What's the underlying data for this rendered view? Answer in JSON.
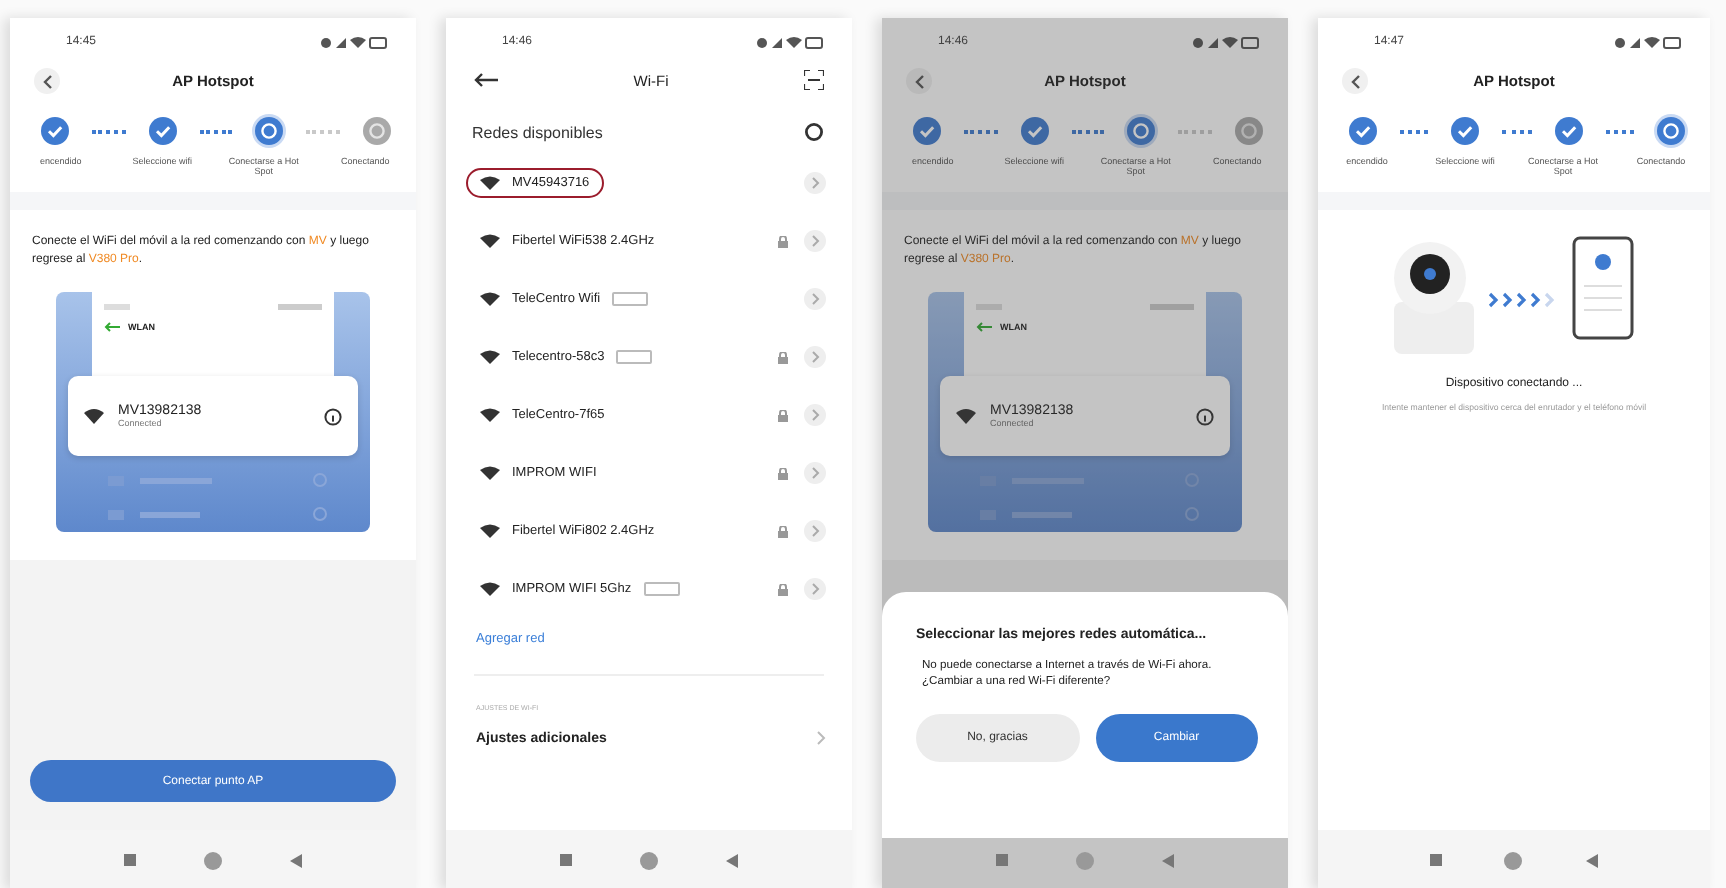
{
  "screens": [
    {
      "kind": "guide",
      "time": "14:45",
      "title": "AP Hotspot",
      "steps": [
        {
          "label": "encendido",
          "done": true,
          "current": false
        },
        {
          "label": "Seleccione wifi",
          "done": true,
          "current": false
        },
        {
          "label": "Conectarse a Hot Spot",
          "done": false,
          "current": true
        },
        {
          "label": "Conectando",
          "done": false,
          "current": false
        }
      ],
      "instruction": "Conecte el WiFi del móvil a la red comenzando con **MV** y luego regrese al **V380 Pro**.",
      "preview": {
        "header": "WLAN",
        "network": "MV13982138",
        "status": "Connected"
      },
      "button": "Conectar punto AP"
    },
    {
      "kind": "wifi",
      "time": "14:46",
      "title": "Wi-Fi",
      "section": "Redes disponibles",
      "networks": [
        {
          "name": "MV45943716",
          "secured": false,
          "band_tag": false,
          "circled": true
        },
        {
          "name": "Fibertel WiFi538 2.4GHz",
          "secured": true,
          "band_tag": false,
          "circled": false
        },
        {
          "name": "TeleCentro Wifi",
          "secured": false,
          "band_tag": true,
          "circled": false
        },
        {
          "name": "Telecentro-58c3",
          "secured": true,
          "band_tag": true,
          "circled": false
        },
        {
          "name": "TeleCentro-7f65",
          "secured": true,
          "band_tag": false,
          "circled": false
        },
        {
          "name": "IMPROM WIFI",
          "secured": true,
          "band_tag": false,
          "circled": false
        },
        {
          "name": "Fibertel WiFi802 2.4GHz",
          "secured": true,
          "band_tag": false,
          "circled": false
        },
        {
          "name": "IMPROM WIFI 5Ghz",
          "secured": true,
          "band_tag": true,
          "circled": false
        }
      ],
      "add_network": "Agregar red",
      "settings_heading": "AJUSTES DE WI-FI",
      "settings_item": "Ajustes adicionales"
    },
    {
      "kind": "guide",
      "time": "14:46",
      "title": "AP Hotspot",
      "steps": [
        {
          "label": "encendido",
          "done": true,
          "current": false
        },
        {
          "label": "Seleccione wifi",
          "done": true,
          "current": false
        },
        {
          "label": "Conectarse a Hot Spot",
          "done": false,
          "current": true
        },
        {
          "label": "Conectando",
          "done": false,
          "current": false
        }
      ],
      "instruction": "Conecte el WiFi del móvil a la red comenzando con **MV** y luego regrese al **V380 Pro**.",
      "preview": {
        "header": "WLAN",
        "network": "MV13982138",
        "status": "Connected"
      },
      "dialog": {
        "title": "Seleccionar las mejores redes automática...",
        "message": "No puede conectarse a Internet a través de Wi-Fi ahora. ¿Cambiar a una red Wi-Fi diferente?",
        "cancel": "No, gracias",
        "confirm": "Cambiar"
      }
    },
    {
      "kind": "connecting",
      "time": "14:47",
      "title": "AP Hotspot",
      "steps": [
        {
          "label": "encendido",
          "done": true,
          "current": false
        },
        {
          "label": "Seleccione wifi",
          "done": true,
          "current": false
        },
        {
          "label": "Conectarse a Hot Spot",
          "done": true,
          "current": false
        },
        {
          "label": "Conectando",
          "done": false,
          "current": true
        }
      ],
      "heading": "Dispositivo conectando ...",
      "message": "Intente mantener el dispositivo cerca del enrutador y el teléfono móvil"
    }
  ]
}
